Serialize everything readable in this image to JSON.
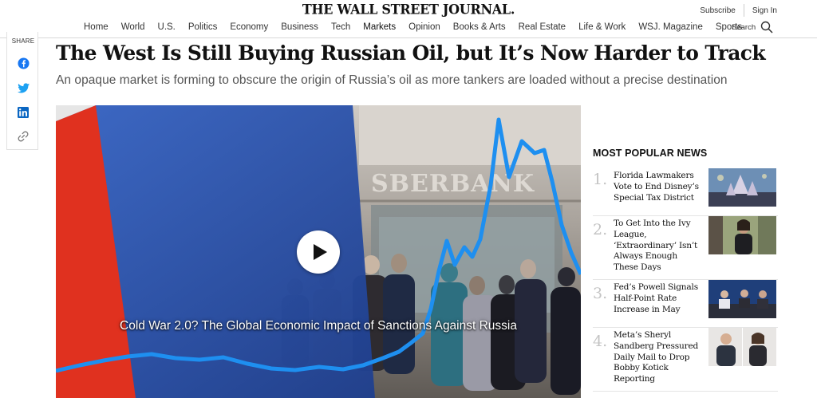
{
  "header": {
    "logo": "THE WALL STREET JOURNAL.",
    "subscribe_label": "Subscribe",
    "signin_label": "Sign In",
    "search_label": "Search",
    "nav": [
      {
        "label": "Home"
      },
      {
        "label": "World"
      },
      {
        "label": "U.S."
      },
      {
        "label": "Politics"
      },
      {
        "label": "Economy"
      },
      {
        "label": "Business"
      },
      {
        "label": "Tech"
      },
      {
        "label": "Markets"
      },
      {
        "label": "Opinion"
      },
      {
        "label": "Books & Arts"
      },
      {
        "label": "Real Estate"
      },
      {
        "label": "Life & Work"
      },
      {
        "label": "WSJ. Magazine"
      },
      {
        "label": "Sports"
      }
    ]
  },
  "share": {
    "label": "SHARE",
    "buttons": [
      "facebook-icon",
      "twitter-icon",
      "linkedin-icon",
      "link-icon"
    ]
  },
  "article": {
    "headline": "The West Is Still Buying Russian Oil, but It’s Now Harder to Track",
    "dek": "An opaque market is forming to obscure the origin of Russia’s oil as more tankers are loaded without a precise destination"
  },
  "video": {
    "title": "Cold War 2.0? The Global Economic Impact of Sanctions Against Russia",
    "bank_sign": "SBERBANK"
  },
  "most_popular": {
    "title": "MOST POPULAR NEWS",
    "items": [
      {
        "num": "1.",
        "text": "Florida Lawmakers Vote to End Disney’s Special Tax District"
      },
      {
        "num": "2.",
        "text": "To Get Into the Ivy League, ‘Extraordinary’ Isn’t Always Enough These Days"
      },
      {
        "num": "3.",
        "text": "Fed’s Powell Signals Half-Point Rate Increase in May"
      },
      {
        "num": "4.",
        "text": "Meta’s Sheryl Sandberg Pressured Daily Mail to Drop Bobby Kotick Reporting"
      }
    ]
  },
  "colors": {
    "chart_line": "#1e8ff0",
    "flag_red": "#e0311f",
    "flag_blue": "#2b56b8"
  }
}
